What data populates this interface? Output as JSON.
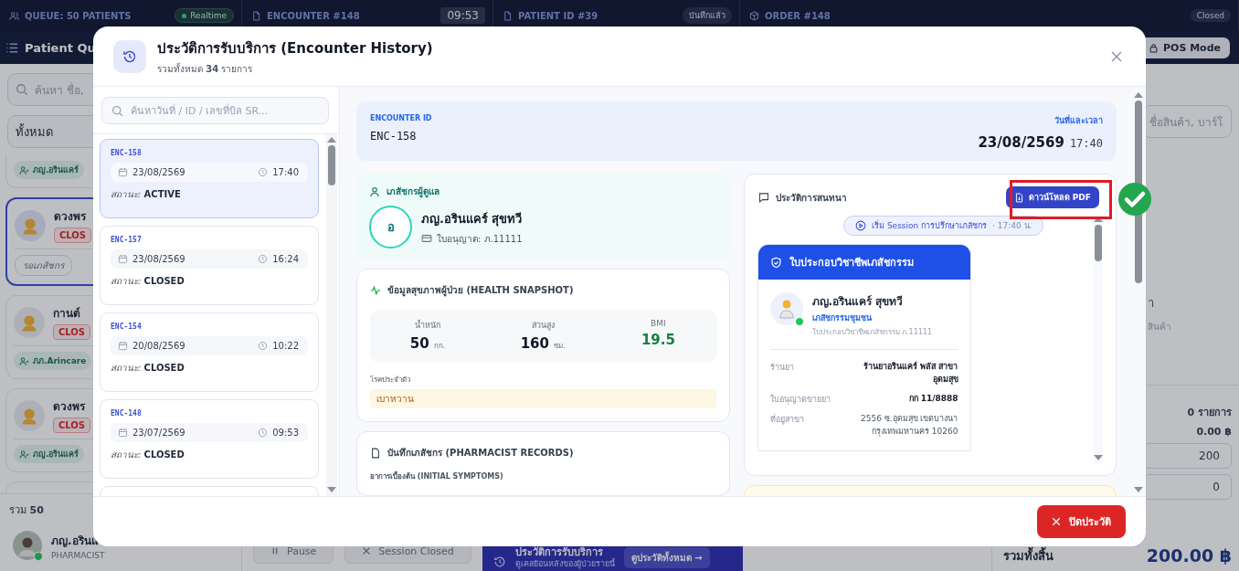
{
  "app": {
    "status_bar": [
      {
        "label": "QUEUE: 50 PATIENTS",
        "badge": "Realtime",
        "kind": "live"
      },
      {
        "label": "ENCOUNTER #148",
        "badge": "09:53",
        "kind": "time"
      },
      {
        "label": "PATIENT ID #39",
        "badge": "บันทึกแล้ว",
        "kind": "pill"
      },
      {
        "label": "ORDER #148",
        "badge": "Closed",
        "kind": "pill"
      }
    ],
    "page_title": "Patient Qu",
    "pos_mode_button": "POS Mode",
    "queue": {
      "search_placeholder": "ค้นหา ชื่อ,",
      "filter": "ทั้งหมด",
      "cards": [
        {
          "footer": "ภญ.อรินแคร์",
          "kind": "pharmacist",
          "selected": false
        },
        {
          "name": "ดวงพร",
          "status": "CLOS",
          "footer": "รอเภสัชกร",
          "kind": "waiting",
          "selected": true
        },
        {
          "name": "กานต์",
          "status": "CLOS",
          "footer": "ภภ.Arincare",
          "kind": "pharmacist",
          "selected": false
        },
        {
          "name": "ดวงพร",
          "status": "CLOS",
          "footer": "ภญ.อรินแคร์",
          "kind": "pharmacist",
          "selected": false
        }
      ],
      "total_label": "รวม",
      "total": "50"
    },
    "user": {
      "name": "ภญ.อรินแ",
      "role": "PHARMACIST",
      "online": true
    },
    "footer": {
      "pause": "Pause",
      "session": "Session Closed",
      "history_title": "ประวัติการรับบริการ",
      "history_subtitle": "ดูเคสย้อนหลังของผู้ป่วยรายนี้",
      "history_button": "ดูประวัติทั้งหมด →"
    },
    "cart": {
      "search_placeholder": "ชื่อสินค้า, บาร์โ",
      "empty_title": "า",
      "empty_text": "สินค้า",
      "items_count": "0 รายการ",
      "discount": "0.00 ฿",
      "fields": [
        "200",
        "0"
      ],
      "total_label": "รวมทั้งสิ้น",
      "total": "200.00 ฿"
    }
  },
  "encounter_history": {
    "title": "ประวัติการรับบริการ (Encounter History)",
    "subtitle": "รวมทั้งหมด **34** รายการ",
    "search_placeholder": "ค้นหาวันที่ / ID / เลขที่บิล SR...",
    "encounters": [
      {
        "id": "ENC-158",
        "date": "23/08/2569",
        "time": "17:40",
        "status_label": "สถานะ:",
        "status": "ACTIVE",
        "selected": true
      },
      {
        "id": "ENC-157",
        "date": "23/08/2569",
        "time": "16:24",
        "status_label": "สถานะ:",
        "status": "CLOSED",
        "selected": false
      },
      {
        "id": "ENC-154",
        "date": "20/08/2569",
        "time": "10:22",
        "status_label": "สถานะ:",
        "status": "CLOSED",
        "selected": false
      },
      {
        "id": "ENC-148",
        "date": "23/07/2569",
        "time": "09:53",
        "status_label": "สถานะ:",
        "status": "CLOSED",
        "selected": false
      }
    ],
    "detail": {
      "encounter_id_label": "ENCOUNTER ID",
      "encounter_id": "ENC-158",
      "datetime_label": "วันที่และเวลา",
      "date": "23/08/2569",
      "time": "17:40",
      "pharmacist": {
        "heading": "เภสัชกรผู้ดูแล",
        "initial": "อ",
        "name": "ภญ.อรินแคร์ สุขทวี",
        "license": "ใบอนุญาต: ภ.11111"
      },
      "health": {
        "heading": "ข้อมูลสุขภาพผู้ป่วย (HEALTH SNAPSHOT)",
        "stats": [
          {
            "label": "น้ำหนัก",
            "value": "50",
            "unit": "กก.",
            "kind": "measure"
          },
          {
            "label": "ส่วนสูง",
            "value": "160",
            "unit": "ซม.",
            "kind": "measure"
          },
          {
            "label": "BMI",
            "value": "19.5",
            "kind": "score"
          }
        ],
        "conditions_label": "โรคประจำตัว",
        "conditions": "เบาหวาน"
      },
      "records": {
        "heading": "บันทึกเภสัชกร (PHARMACIST RECORDS)",
        "symptoms_label": "อาการเบื้องต้น (INITIAL SYMPTOMS)"
      },
      "chat": {
        "heading": "ประวัติการสนทนา",
        "download_button": "ดาวน์โหลด PDF",
        "session_start": "เริ่ม Session การปรึกษาเภสัชกร",
        "session_time": "· 17:40 น.",
        "license_card": {
          "title": "ใบประกอบวิชาชีพเภสัชกรรม",
          "name": "ภญ.อรินแคร์ สุขทวี",
          "role": "เภสัชกรรมชุมชน",
          "license": "ใบประกอบวิชาชีพเภสัชกรรม ภ.11111",
          "online": true,
          "rows": [
            {
              "label": "ร้านยา",
              "value": "ร้านยาอรินแคร์ พลัส สาขา อุดมสุข",
              "kind": "bold"
            },
            {
              "label": "ใบอนุญาตขายยา",
              "value": "กก 11/8888",
              "kind": "bold"
            },
            {
              "label": "ที่อยู่สาขา",
              "value": "2556 ซ.อุดมสุข เขตบางนา กรุงเทพมหานคร 10260",
              "kind": "plain"
            }
          ]
        }
      }
    },
    "close_button": "ปิดประวัติ"
  }
}
